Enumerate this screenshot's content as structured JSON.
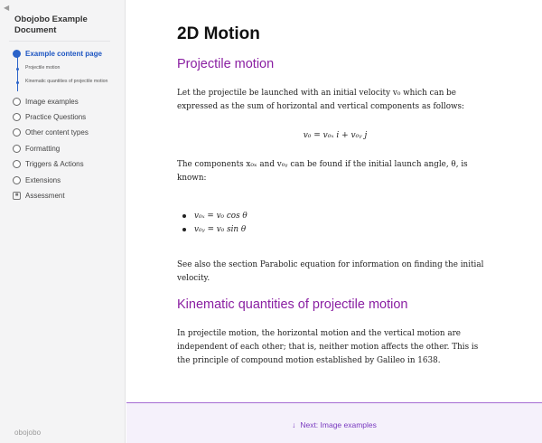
{
  "sidebar": {
    "collapse_icon": "◀",
    "title": "Obojobo Example Document",
    "items": [
      {
        "label": "Example content page",
        "active": true
      },
      {
        "label": "Image examples"
      },
      {
        "label": "Practice Questions"
      },
      {
        "label": "Other content types"
      },
      {
        "label": "Formatting"
      },
      {
        "label": "Triggers & Actions"
      },
      {
        "label": "Extensions"
      },
      {
        "label": "Assessment",
        "icon": "lock-icon",
        "glyph": "🔒"
      }
    ],
    "subitems": [
      {
        "label": "Projectile motion"
      },
      {
        "label": "Kinematic quantities of projectile motion"
      }
    ],
    "logo": "obojobo",
    "accent": "#2b63c9"
  },
  "main": {
    "page_title": "2D Motion",
    "section1_heading": "Projectile motion",
    "para1": "Let the projectile be launched with an initial velocity v₀ which can be expressed as the sum of horizontal and vertical components as follows:",
    "equation": "v₀ = v₀ₓ i + v₀ᵧ j",
    "para2": "The components x₀ₓ and v₀ᵧ can be found if the initial launch angle, θ, is known:",
    "bullets": [
      "v₀ₓ = v₀ cos θ",
      "v₀ᵧ = v₀ sin θ"
    ],
    "para3": "See also the section Parabolic equation for information on finding the initial velocity.",
    "section2_heading": "Kinematic quantities of projectile motion",
    "para4": "In projectile motion, the horizontal motion and the vertical motion are independent of each other; that is, neither motion affects the other. This is the principle of compound motion established by Galileo in 1638.",
    "heading_color": "#8a1fa2"
  },
  "footer": {
    "next_label": "Next: Image examples",
    "next_icon": "↓"
  }
}
